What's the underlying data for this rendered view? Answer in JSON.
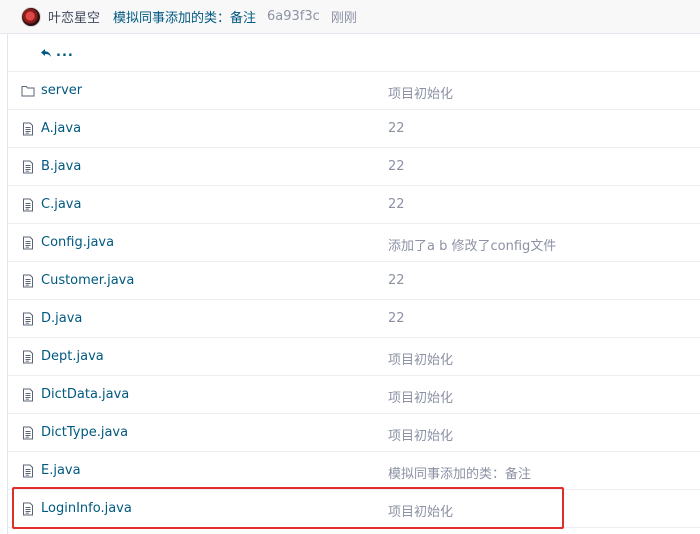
{
  "commit": {
    "author": "叶恋星空",
    "message": "模拟同事添加的类：备注",
    "sha": "6a93f3c",
    "time": "刚刚"
  },
  "navigation": {
    "up_label": "..."
  },
  "files": [
    {
      "name": "server",
      "type": "folder",
      "message": "项目初始化"
    },
    {
      "name": "A.java",
      "type": "file",
      "message": "22"
    },
    {
      "name": "B.java",
      "type": "file",
      "message": "22"
    },
    {
      "name": "C.java",
      "type": "file",
      "message": "22"
    },
    {
      "name": "Config.java",
      "type": "file",
      "message": "添加了a b 修改了config文件"
    },
    {
      "name": "Customer.java",
      "type": "file",
      "message": "22"
    },
    {
      "name": "D.java",
      "type": "file",
      "message": "22"
    },
    {
      "name": "Dept.java",
      "type": "file",
      "message": "项目初始化"
    },
    {
      "name": "DictData.java",
      "type": "file",
      "message": "项目初始化"
    },
    {
      "name": "DictType.java",
      "type": "file",
      "message": "项目初始化"
    },
    {
      "name": "E.java",
      "type": "file",
      "message": "模拟同事添加的类：备注",
      "highlighted": true
    },
    {
      "name": "LoginInfo.java",
      "type": "file",
      "message": "项目初始化"
    }
  ],
  "colors": {
    "link": "#005980",
    "muted": "#8c92a4",
    "highlight_border": "#e02c2c"
  },
  "icons": {
    "folder": "folder-icon",
    "file": "file-icon",
    "up": "back-arrow-icon"
  }
}
